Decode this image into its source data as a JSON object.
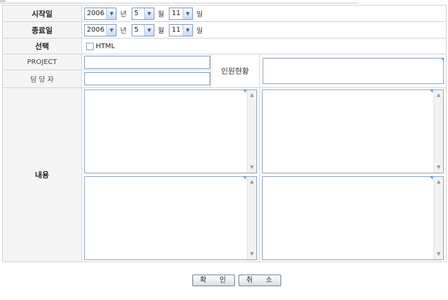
{
  "form": {
    "start_label": "시작일",
    "end_label": "종료일",
    "select_label": "선택",
    "project_label": "PROJECT",
    "manager_label": "담 당 자",
    "staff_label": "인원현황",
    "content_label": "내용",
    "html_checkbox": {
      "label": "HTML",
      "checked": false
    },
    "start_date": {
      "year": "2006",
      "month": "5",
      "day": "11"
    },
    "end_date": {
      "year": "2006",
      "month": "5",
      "day": "11"
    },
    "units": {
      "year": "년",
      "month": "월",
      "day": "일"
    },
    "project_value": "",
    "manager_value": ""
  },
  "buttons": {
    "confirm": "확 인",
    "cancel": "취 소"
  },
  "icons": {
    "dropdown": "chevron-down-icon",
    "scroll_up": "chevron-up-icon",
    "scroll_down": "chevron-down-icon"
  },
  "colors": {
    "label_bg": "#f5f5f5",
    "border": "#d3d3d3",
    "input_border": "#7f9db9",
    "corner_mark": "#5aa0e6"
  }
}
